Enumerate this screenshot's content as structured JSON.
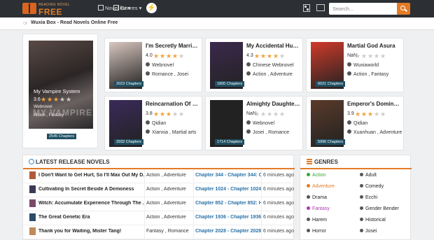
{
  "header": {
    "logo_small": "READING NOVEL",
    "logo_big": "FREE",
    "nav_novel_list": "Novel list ▾",
    "nav_genres": "Genres ▾",
    "search_placeholder": "Search..."
  },
  "subbar": {
    "text": "Wuxia Box - Read Novels Online Free"
  },
  "featured": {
    "title": "My Vampire System",
    "rating": "3.6",
    "stars": 3,
    "category1": "Webnovel",
    "category2": "Action , Fantasy",
    "chapters": "2545 Chapters",
    "cover_text": "MY VAMPIRE"
  },
  "cards": [
    {
      "title": "I'm Secretly Married t...",
      "rating": "4.0",
      "stars": 4,
      "source": "Webnovel",
      "genres": "Romance , Josei",
      "chapters": "2023 Chapters",
      "color": "#d9c7bf"
    },
    {
      "title": "My Accidental Husba...",
      "rating": "4.3",
      "stars": 4,
      "source": "Chinese Webnovel",
      "genres": "Action , Adventure",
      "chapters": "1800 Chapters",
      "color": "#3b2a4d"
    },
    {
      "title": "Martial God Asura",
      "rating": "NaN",
      "stars": 0,
      "source": "Wuxiaworld",
      "genres": "Action , Fantasy",
      "chapters": "6021 Chapters",
      "color": "#d03a2a"
    },
    {
      "title": "Reincarnation Of The ...",
      "rating": "3.8",
      "stars": 3,
      "source": "Qidian",
      "genres": "Xianxia , Martial arts",
      "chapters": "2932 Chapters",
      "color": "#3a2b5a"
    },
    {
      "title": "Almighty Daughter R...",
      "rating": "NaN",
      "stars": 0,
      "source": "Webnovel",
      "genres": "Josei , Romance",
      "chapters": "1714 Chapters",
      "color": "#222222"
    },
    {
      "title": "Emperor's Domination",
      "rating": "3.9",
      "stars": 3,
      "source": "Qidian",
      "genres": "Xuanhuan , Adventure",
      "chapters": "5996 Chapters",
      "color": "#5a3a2a"
    }
  ],
  "latest": {
    "heading": "LATEST RELEASE NOVELS",
    "rows": [
      {
        "name": "I Don't Want to Get Hurt, So I'll Max Out My D...",
        "genre": "Action , Adventure",
        "chapter": "Chapter 344 - Chapter 344: C...",
        "time": "6 minutes ago",
        "thumb": "#b05a3a"
      },
      {
        "name": "Cultivating In Secret Beside A Demoness",
        "genre": "Action , Adventure",
        "chapter": "Chapter 1024 - Chapter 1024: ...",
        "time": "6 minutes ago",
        "thumb": "#3a3a55"
      },
      {
        "name": "Witch: Accumulate Experience Through The ...",
        "genre": "Action , Adventure",
        "chapter": "Chapter 852 - Chapter 852: H...",
        "time": "6 minutes ago",
        "thumb": "#7a4a6a"
      },
      {
        "name": "The Great Genetic Era",
        "genre": "Action , Adventure",
        "chapter": "Chapter 1936 - Chapter 1936: ...",
        "time": "6 minutes ago",
        "thumb": "#2a4a6a"
      },
      {
        "name": "Thank you for Waiting, Mister Tang!",
        "genre": "Fantasy , Romance",
        "chapter": "Chapter 2028 - Chapter 2028: ...",
        "time": "6 minutes ago",
        "thumb": "#c08a5a"
      }
    ]
  },
  "genres": {
    "heading": "GENRES",
    "items": [
      {
        "label": "Action",
        "color": "#3aa63a"
      },
      {
        "label": "Adult",
        "color": "#555555"
      },
      {
        "label": "Adventure",
        "color": "#e37b26"
      },
      {
        "label": "Comedy",
        "color": "#555555"
      },
      {
        "label": "Drama",
        "color": "#555555"
      },
      {
        "label": "Ecchi",
        "color": "#555555"
      },
      {
        "label": "Fantasy",
        "color": "#b03ab0"
      },
      {
        "label": "Gender Bender",
        "color": "#555555"
      },
      {
        "label": "Harem",
        "color": "#555555"
      },
      {
        "label": "Historical",
        "color": "#555555"
      },
      {
        "label": "Horror",
        "color": "#555555"
      },
      {
        "label": "Josei",
        "color": "#555555"
      }
    ]
  }
}
